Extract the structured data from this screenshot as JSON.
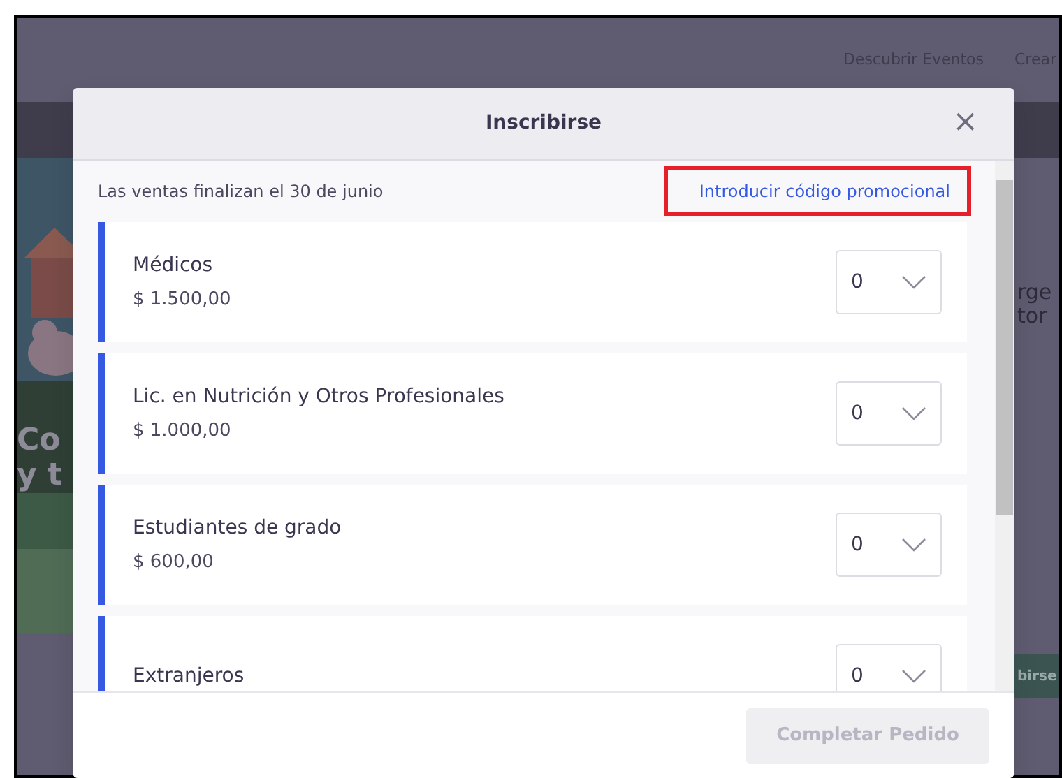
{
  "background": {
    "nav_links": [
      "Descubrir Eventos",
      "Crear"
    ],
    "left_texts": [
      "Co",
      "y t"
    ],
    "right_texts": [
      "rge",
      "tor"
    ],
    "button": "birse"
  },
  "modal": {
    "title": "Inscribirse",
    "close": "×",
    "sales_end": "Las ventas finalizan el 30 de junio",
    "promo": {
      "label": "Introducir código promocional",
      "highlighted": true
    },
    "tickets": [
      {
        "name": "Médicos",
        "price": "$ 1.500,00",
        "quantity": "0"
      },
      {
        "name": "Lic. en Nutrición y Otros Profesionales",
        "price": "$ 1.000,00",
        "quantity": "0"
      },
      {
        "name": "Estudiantes de grado",
        "price": "$ 600,00",
        "quantity": "0"
      },
      {
        "name": "Extranjeros",
        "quantity": "0"
      }
    ],
    "checkout": {
      "label": "Completar Pedido",
      "disabled": true
    }
  }
}
